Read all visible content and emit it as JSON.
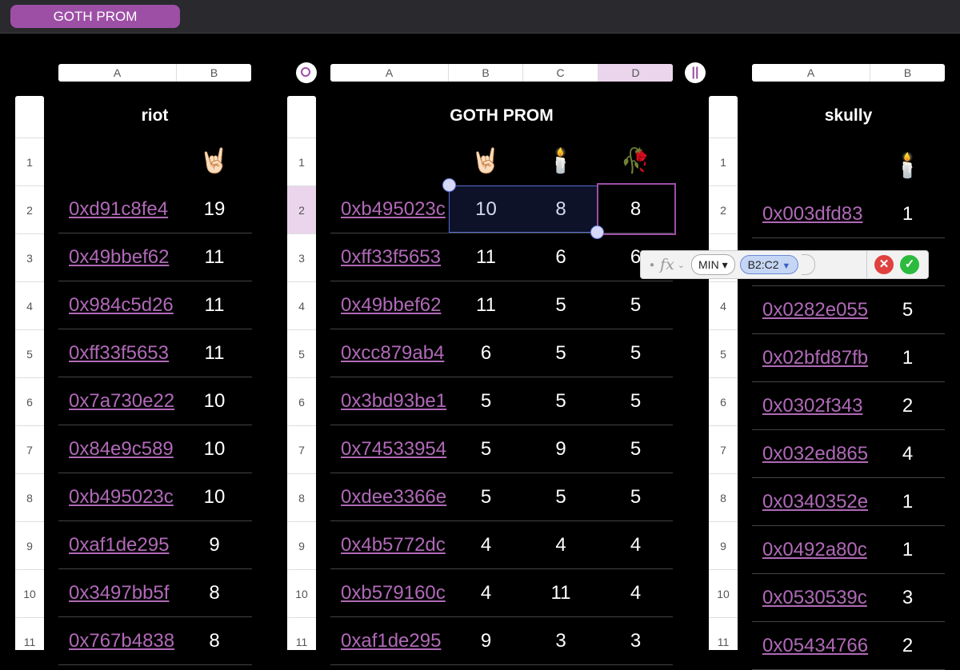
{
  "sheet_tab": "GOTH PROM",
  "left_table": {
    "columns": [
      "A",
      "B"
    ],
    "title": "riot",
    "emoji_header": [
      "",
      "🤘🏻"
    ],
    "row_numbers": [
      "1",
      "2",
      "3",
      "4",
      "5",
      "6",
      "7",
      "8",
      "9",
      "10",
      "11"
    ],
    "rows": [
      [
        "0xd91c8fe4",
        "19"
      ],
      [
        "0x49bbef62",
        "11"
      ],
      [
        "0x984c5d26",
        "11"
      ],
      [
        "0xff33f5653",
        "11"
      ],
      [
        "0x7a730e22",
        "10"
      ],
      [
        "0x84e9c589",
        "10"
      ],
      [
        "0xb495023c",
        "10"
      ],
      [
        "0xaf1de295",
        "9"
      ],
      [
        "0x3497bb5f",
        "8"
      ],
      [
        "0x767b4838",
        "8"
      ]
    ]
  },
  "middle_table": {
    "columns": [
      "A",
      "B",
      "C",
      "D"
    ],
    "selected_column": "D",
    "title": "GOTH PROM",
    "emoji_header": [
      "",
      "🤘🏻",
      "🕯️",
      "🥀"
    ],
    "row_numbers": [
      "1",
      "2",
      "3",
      "4",
      "5",
      "6",
      "7",
      "8",
      "9",
      "10",
      "11"
    ],
    "selected_row": "2",
    "rows": [
      [
        "0xb495023c",
        "10",
        "8",
        "8"
      ],
      [
        "0xff33f5653",
        "11",
        "6",
        "6"
      ],
      [
        "0x49bbef62",
        "11",
        "5",
        "5"
      ],
      [
        "0xcc879ab4",
        "6",
        "5",
        "5"
      ],
      [
        "0x3bd93be1",
        "5",
        "5",
        "5"
      ],
      [
        "0x74533954",
        "5",
        "9",
        "5"
      ],
      [
        "0xdee3366e",
        "5",
        "5",
        "5"
      ],
      [
        "0x4b5772dc",
        "4",
        "4",
        "4"
      ],
      [
        "0xb579160c",
        "4",
        "11",
        "4"
      ],
      [
        "0xaf1de295",
        "9",
        "3",
        "3"
      ]
    ]
  },
  "right_table": {
    "columns": [
      "A",
      "B"
    ],
    "title": "skully",
    "emoji_header": [
      "",
      "🕯️"
    ],
    "row_numbers": [
      "1",
      "2",
      "3",
      "4",
      "5",
      "6",
      "7",
      "8",
      "9",
      "10",
      "11"
    ],
    "rows": [
      [
        "0x003dfd83",
        "1"
      ],
      [
        "",
        ""
      ],
      [
        "0x0282e055",
        "5"
      ],
      [
        "0x02bfd87fb",
        "1"
      ],
      [
        "0x0302f343",
        "2"
      ],
      [
        "0x032ed865",
        "4"
      ],
      [
        "0x0340352e",
        "1"
      ],
      [
        "0x0492a80c",
        "1"
      ],
      [
        "0x0530539c",
        "3"
      ],
      [
        "0x05434766",
        "2"
      ]
    ]
  },
  "formula_bar": {
    "fx": "fx",
    "function": "MIN",
    "reference": "B2:C2"
  },
  "colors": {
    "accent": "#9d4fa6",
    "link": "#b069b7",
    "selection": "#5a6bd6"
  }
}
